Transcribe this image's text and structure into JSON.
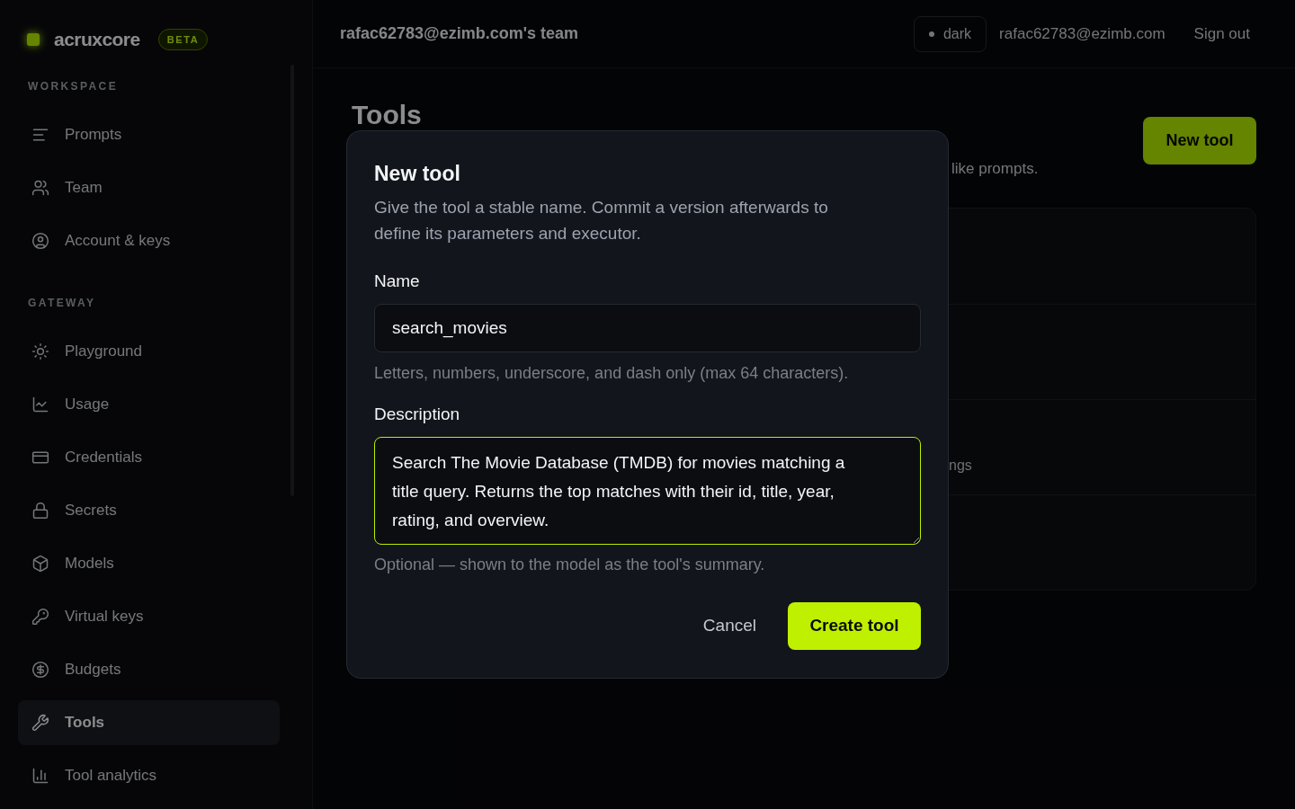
{
  "sidebar": {
    "brand": {
      "name": "acruxcore",
      "badge": "BETA"
    },
    "sections": [
      {
        "title": "WORKSPACE",
        "items": [
          {
            "label": "Prompts",
            "selected": false
          },
          {
            "label": "Team",
            "selected": false
          },
          {
            "label": "Account & keys",
            "selected": false
          }
        ]
      },
      {
        "title": "GATEWAY",
        "items": [
          {
            "label": "Playground",
            "selected": false
          },
          {
            "label": "Usage",
            "selected": false
          },
          {
            "label": "Credentials",
            "selected": false
          },
          {
            "label": "Secrets",
            "selected": false
          },
          {
            "label": "Models",
            "selected": false
          },
          {
            "label": "Virtual keys",
            "selected": false
          },
          {
            "label": "Budgets",
            "selected": false
          },
          {
            "label": "Tools",
            "selected": true
          },
          {
            "label": "Tool analytics",
            "selected": false
          }
        ]
      }
    ]
  },
  "top_bar": {
    "team": "rafac62783@ezimb.com's team",
    "theme_toggle": "dark",
    "user_email": "rafac62783@ezimb.com",
    "sign_out": "Sign out"
  },
  "page": {
    "title": "Tools",
    "description": "like prompts.",
    "new_button": "New tool",
    "tool_list": {
      "rows": [
        {
          "kind": "blank"
        },
        {
          "kind": "blank"
        },
        {
          "kind": "text",
          "text": "ngs"
        },
        {
          "kind": "blank"
        }
      ]
    }
  },
  "dialog": {
    "title": "New tool",
    "description": "Give the tool a stable name. Commit a version afterwards to define its parameters and executor.",
    "fields": [
      {
        "kind": "input",
        "label": "Name",
        "value": "search_movies",
        "focused": false,
        "hint": "Letters, numbers, underscore, and dash only (max 64 characters)."
      },
      {
        "kind": "textarea",
        "label": "Description",
        "value": "Search The Movie Database (TMDB) for movies matching a title query. Returns the top matches with their id, title, year, rating, and overview.",
        "focused": true,
        "hint": "Optional — shown to the model as the tool's summary."
      }
    ],
    "buttons": {
      "cancel": "Cancel",
      "submit": "Create tool"
    }
  }
}
